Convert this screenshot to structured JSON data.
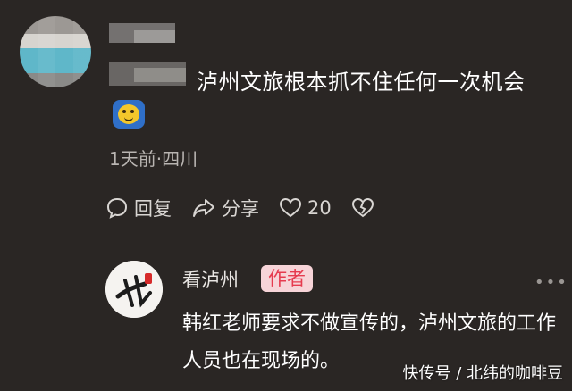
{
  "comment": {
    "text": "泸州文旅根本抓不住任何一次机会",
    "emoji_icon": "grinning-face-emoji",
    "meta": "1天前·四川",
    "actions": {
      "reply_label": "回复",
      "share_label": "分享",
      "like_count": "20"
    }
  },
  "author_reply": {
    "author_name": "看泸州",
    "badge": "作者",
    "more_icon": "more-dots-icon",
    "text": "韩红老师要求不做宣传的，泸州文旅的工作人员也在现场的。"
  },
  "watermark": "快传号 / 北纬的咖啡豆",
  "colors": {
    "background": "#2a2624",
    "badge_bg": "#f7d4d8",
    "badge_text": "#e63b4f",
    "meta_text": "#b9b5b2"
  }
}
